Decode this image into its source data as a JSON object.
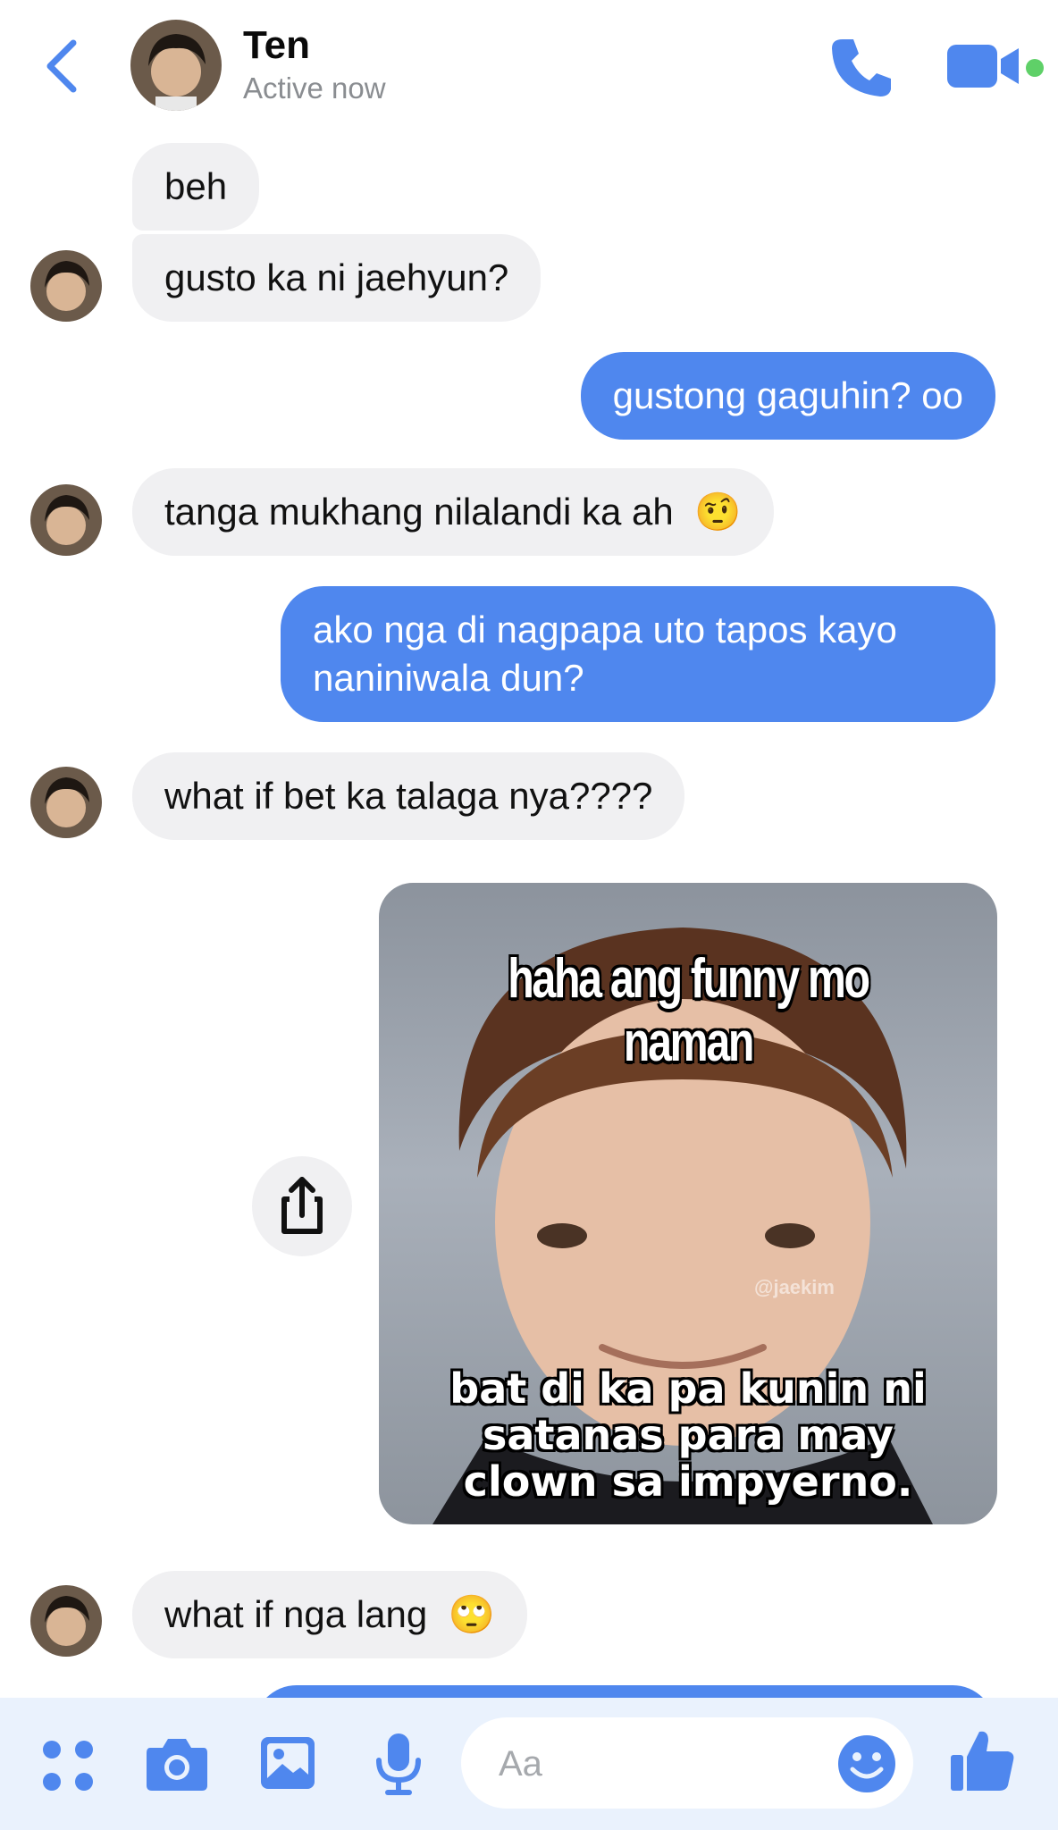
{
  "header": {
    "contact_name": "Ten",
    "status": "Active now",
    "back_icon": "chevron-left-icon",
    "call_icon": "phone-icon",
    "video_icon": "video-camera-icon"
  },
  "messages": [
    {
      "side": "in",
      "text": "beh"
    },
    {
      "side": "in",
      "text": "gusto ka ni jaehyun?"
    },
    {
      "side": "out",
      "text": "gustong gaguhin? oo"
    },
    {
      "side": "in",
      "text": "tanga mukhang nilalandi ka ah",
      "emoji": "🤨"
    },
    {
      "side": "out",
      "line1": "ako nga di nagpapa uto tapos kayo",
      "line2": "naniniwala dun?"
    },
    {
      "side": "in",
      "text": "what if bet ka talaga nya????"
    },
    {
      "side": "out",
      "type": "image",
      "top_text": "haha ang funny mo naman",
      "bottom_line1": "bat di ka pa kunin ni",
      "bottom_line2": "satanas para may",
      "bottom_line3": "clown sa impyerno.",
      "watermark": "@jaekim"
    },
    {
      "side": "in",
      "text": "what if nga lang",
      "emoji": "🙄"
    }
  ],
  "composer": {
    "placeholder": "Aa",
    "icons": [
      "apps-icon",
      "camera-icon",
      "image-icon",
      "microphone-icon",
      "emoji-icon",
      "thumbs-up-icon"
    ]
  },
  "colors": {
    "accent": "#4f87ee",
    "incoming_bubble": "#f0f0f2",
    "online": "#5fd068"
  }
}
